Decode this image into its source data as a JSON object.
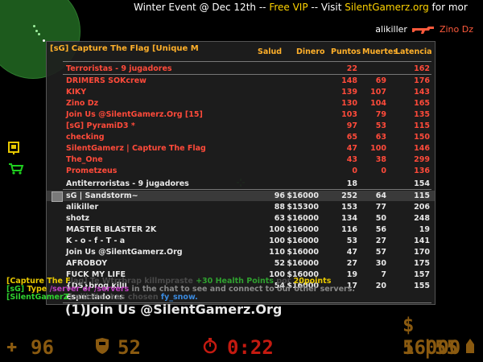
{
  "banner": {
    "part1": "Winter Event @ Dec 12th --",
    "part2": "Free VIP",
    "part3": "-- Visit",
    "part4": "SilentGamerz.org",
    "part5": "for mor"
  },
  "killfeed": {
    "killer": "alikiller",
    "victim": "Zino Dz",
    "weapon_icon": "ak47-icon"
  },
  "scoreboard": {
    "title": "[sG] Capture The Flag [Unique M",
    "headers": {
      "salud": "Salud",
      "dinero": "Dinero",
      "puntos": "Puntos",
      "muertes": "Muertes",
      "latencia": "Latencia"
    },
    "terrorists": {
      "label": "Terroristas   -   9 jugadores",
      "puntos": "22",
      "latencia": "162",
      "players": [
        {
          "name": "DRIMERS SOKcrew",
          "puntos": "148",
          "muertes": "69",
          "latencia": "176"
        },
        {
          "name": "KIKY",
          "puntos": "139",
          "muertes": "107",
          "latencia": "143"
        },
        {
          "name": "Zino Dz",
          "puntos": "130",
          "muertes": "104",
          "latencia": "165"
        },
        {
          "name": "Join Us @SilentGamerz.Org [15]",
          "puntos": "103",
          "muertes": "79",
          "latencia": "135"
        },
        {
          "name": "[sG] PyramiD3 *",
          "puntos": "97",
          "muertes": "53",
          "latencia": "115"
        },
        {
          "name": "checking",
          "puntos": "65",
          "muertes": "63",
          "latencia": "150"
        },
        {
          "name": "SilentGamerz | Capture The Flag",
          "puntos": "47",
          "muertes": "100",
          "latencia": "146"
        },
        {
          "name": "The_One",
          "puntos": "43",
          "muertes": "38",
          "latencia": "299"
        },
        {
          "name": "Prometzeus",
          "puntos": "0",
          "muertes": "0",
          "latencia": "136"
        }
      ]
    },
    "counter_terrorists": {
      "label": "Antiterroristas   -   9 jugadores",
      "puntos": "18",
      "latencia": "154",
      "players": [
        {
          "name": "sG | Sandstorm~",
          "salud": "96",
          "dinero": "$16000",
          "puntos": "252",
          "muertes": "64",
          "latencia": "115"
        },
        {
          "name": "alikiller",
          "salud": "88",
          "dinero": "$15300",
          "puntos": "153",
          "muertes": "77",
          "latencia": "206"
        },
        {
          "name": "shotz",
          "salud": "63",
          "dinero": "$16000",
          "puntos": "134",
          "muertes": "50",
          "latencia": "248"
        },
        {
          "name": "MASTER BLASTER 2K",
          "salud": "100",
          "dinero": "$16000",
          "puntos": "116",
          "muertes": "56",
          "latencia": "19"
        },
        {
          "name": "K  -  o  -  f  -  T  -  a",
          "salud": "100",
          "dinero": "$16000",
          "puntos": "53",
          "muertes": "27",
          "latencia": "141"
        },
        {
          "name": "Join Us @SilentGamerz.Org",
          "salud": "110",
          "dinero": "$16000",
          "puntos": "47",
          "muertes": "57",
          "latencia": "170"
        },
        {
          "name": "AFROBOY",
          "salud": "52",
          "dinero": "$16000",
          "puntos": "27",
          "muertes": "30",
          "latencia": "175"
        },
        {
          "name": "FUCK MY LIFE",
          "salud": "100",
          "dinero": "$16000",
          "puntos": "19",
          "muertes": "7",
          "latencia": "157"
        },
        {
          "name": "{DS}brog killl",
          "salud": "54",
          "dinero": "$16000",
          "puntos": "17",
          "muertes": "20",
          "latencia": "155"
        }
      ]
    },
    "spectators": {
      "label": "Espectadores",
      "players": [
        {
          "name": "(1)Join Us @SilentGamerz.Org"
        }
      ]
    }
  },
  "chat": {
    "line1_tag": "[Capture The F",
    "line1_msg": "lag] Te Wtrrbrap kill",
    "line1_a": "mpraste",
    "line1_b": "+30 Health Points",
    "line1_c": "por",
    "line1_d": "20points",
    "line2_tag": "[sG]",
    "line2_a": "Type",
    "line2_b": "/server or /servers",
    "line2_c": "in the chat to see and connect to our other servers.",
    "line3_tag": "[SilentGamerZ",
    "line3_a": "] alikiller",
    "line3_b": "has chosen",
    "line3_c": "fy_snow."
  },
  "hud": {
    "health": "96",
    "armor": "52",
    "timer": "0:22",
    "money": "$ 16000",
    "ammo_clip": "5",
    "ammo_reserve": "55"
  },
  "colors": {
    "terrorist": "#ff4a3a",
    "header": "#ffb02a",
    "hud": "#8a5a10",
    "timer": "#c41a10"
  }
}
